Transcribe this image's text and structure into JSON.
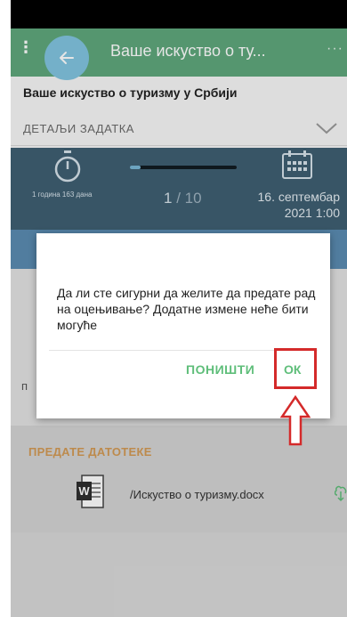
{
  "app_bar": {
    "title": "Ваше искуство о ту...",
    "menu_glyph": "⋮",
    "more_glyph": "···"
  },
  "page": {
    "heading": "Ваше искуство о туризму у Србији",
    "details_label": "ДЕТАЉИ ЗАДАТКА"
  },
  "info": {
    "elapsed": "1 година 163 дана",
    "progress_current": "1",
    "progress_sep": " / ",
    "progress_total": "10",
    "progress_fraction": 0.1,
    "due_line1": "16. септембар",
    "due_line2": "2021 1:00"
  },
  "files": {
    "title": "ПРЕДАТЕ ДАТОТЕКЕ",
    "file_name": "/Искуство о туризму.docx"
  },
  "background": {
    "stub_char": "п"
  },
  "dialog": {
    "message": "Да ли сте сигурни да желите да предате рад на оцењивање? Додатне измене неће бити могуће",
    "cancel_label": "ПОНИШТИ",
    "ok_label": "ОК"
  },
  "colors": {
    "app_bar": "#5fa87c",
    "info_bar": "#3f5f72",
    "accent_green": "#5fbe7a",
    "annotation_red": "#d42a2a"
  }
}
